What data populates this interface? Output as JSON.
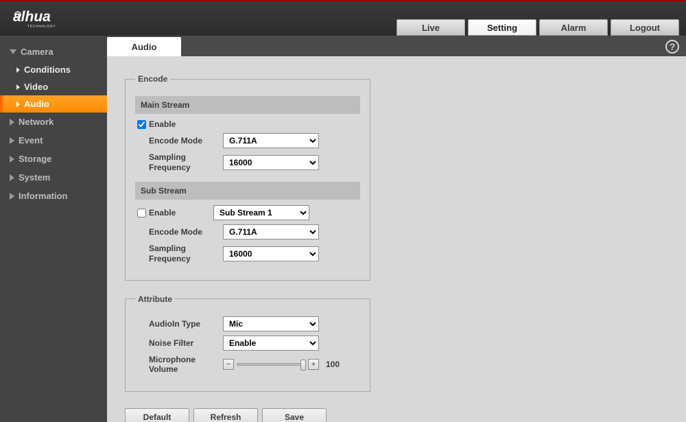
{
  "brand": {
    "name": "alhua",
    "sub": "TECHNOLOGY"
  },
  "topnav": {
    "live": "Live",
    "setting": "Setting",
    "alarm": "Alarm",
    "logout": "Logout",
    "active": "setting"
  },
  "sidebar": {
    "camera": {
      "label": "Camera",
      "expanded": true,
      "items": {
        "conditions": "Conditions",
        "video": "Video",
        "audio": "Audio"
      },
      "active": "audio"
    },
    "network": "Network",
    "event": "Event",
    "storage": "Storage",
    "system": "System",
    "information": "Information"
  },
  "tab": {
    "label": "Audio"
  },
  "help_glyph": "?",
  "encode": {
    "legend": "Encode",
    "main": {
      "title": "Main Stream",
      "enable_label": "Enable",
      "enable_checked": true,
      "mode_label": "Encode Mode",
      "mode_value": "G.711A",
      "freq_label": "Sampling Frequency",
      "freq_value": "16000"
    },
    "sub": {
      "title": "Sub Stream",
      "enable_label": "Enable",
      "enable_checked": false,
      "stream_value": "Sub Stream 1",
      "mode_label": "Encode Mode",
      "mode_value": "G.711A",
      "freq_label": "Sampling Frequency",
      "freq_value": "16000"
    }
  },
  "attribute": {
    "legend": "Attribute",
    "audioin_label": "AudioIn Type",
    "audioin_value": "Mic",
    "noise_label": "Noise Filter",
    "noise_value": "Enable",
    "vol_label": "Microphone Volume",
    "vol_value": "100",
    "vol_pct": 100
  },
  "buttons": {
    "default": "Default",
    "refresh": "Refresh",
    "save": "Save"
  }
}
